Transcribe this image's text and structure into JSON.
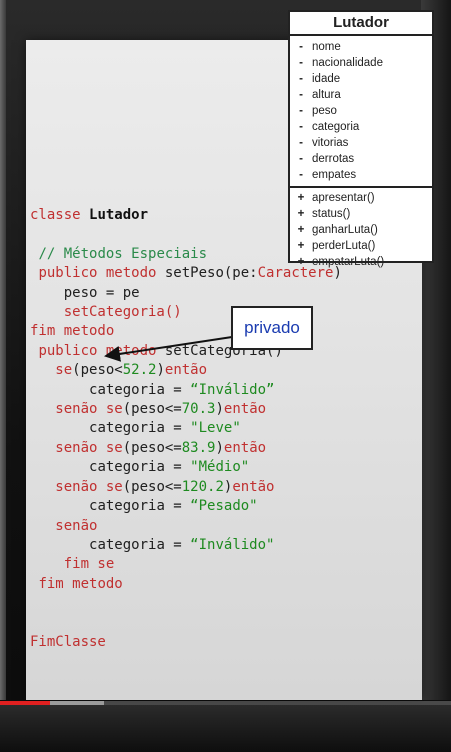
{
  "uml": {
    "title": "Lutador",
    "attributes": [
      {
        "mark": "-",
        "name": "nome"
      },
      {
        "mark": "-",
        "name": "nacionalidade"
      },
      {
        "mark": "-",
        "name": "idade"
      },
      {
        "mark": "-",
        "name": "altura"
      },
      {
        "mark": "-",
        "name": "peso"
      },
      {
        "mark": "-",
        "name": "categoria"
      },
      {
        "mark": "-",
        "name": "vitorias"
      },
      {
        "mark": "-",
        "name": "derrotas"
      },
      {
        "mark": "-",
        "name": "empates"
      }
    ],
    "methods": [
      {
        "mark": "+",
        "name": "apresentar()"
      },
      {
        "mark": "+",
        "name": "status()"
      },
      {
        "mark": "+",
        "name": "ganharLuta()"
      },
      {
        "mark": "+",
        "name": "perderLuta()"
      },
      {
        "mark": "+",
        "name": "empatarLuta()"
      }
    ]
  },
  "code": {
    "l1_kw": "classe",
    "l1_name": "Lutador",
    "l2": "// Métodos Especiais",
    "l3_kw": "publico metodo",
    "l3_rest": " setPeso(pe:",
    "l3_type": "Caractere",
    "l3_end": ")",
    "l4": "peso = pe",
    "l5": "setCategoria()",
    "l6": "fim metodo",
    "l7_kw": "publico metodo",
    "l7_rest": " setCategoria()",
    "l8_kw": "se",
    "l8_a": "(peso<",
    "l8_num": "52.2",
    "l8_b": ")",
    "l8_kw2": "então",
    "l9_a": "categoria = ",
    "l9_str": "“Inválido”",
    "l10_kw": "senão se",
    "l10_a": "(peso<=",
    "l10_num": "70.3",
    "l10_b": ")",
    "l10_kw2": "então",
    "l11_a": "categoria = ",
    "l11_str": "\"Leve\"",
    "l12_kw": "senão se",
    "l12_a": "(peso<=",
    "l12_num": "83.9",
    "l12_b": ")",
    "l12_kw2": "então",
    "l13_a": "categoria = ",
    "l13_str": "\"Médio\"",
    "l14_kw": "senão se",
    "l14_a": "(peso<=",
    "l14_num": "120.2",
    "l14_b": ")",
    "l14_kw2": "então",
    "l15_a": "categoria = ",
    "l15_str": "“Pesado\"",
    "l16": "senão",
    "l17_a": "categoria = ",
    "l17_str": "“Inválido\"",
    "l18": "fim se",
    "l19": "fim metodo",
    "l20": "FimClasse"
  },
  "callout": {
    "label": "privado"
  },
  "player": {
    "progress": 0.11,
    "buffered": 0.23,
    "accent": "#e02020"
  }
}
